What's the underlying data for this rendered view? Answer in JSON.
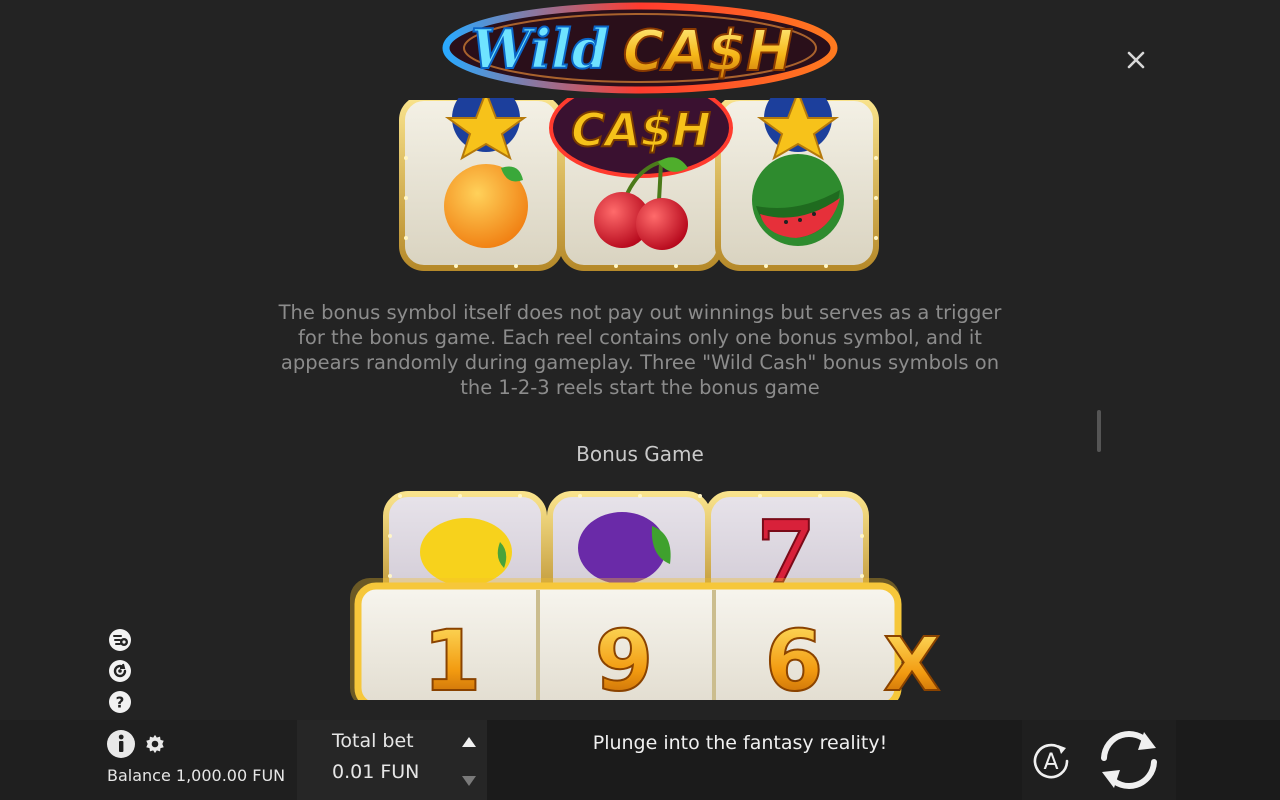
{
  "header": {
    "logo_text_1": "Wild",
    "logo_text_2": "CA$H",
    "close_icon": "close-icon"
  },
  "content": {
    "illustration_1": {
      "cash_text": "CA$H",
      "symbols": [
        "star-icon",
        "orange-icon",
        "cherry-icon",
        "watermelon-icon"
      ]
    },
    "description": "The bonus symbol itself does not pay out winnings but serves as a trigger for the bonus game. Each reel contains only one bonus symbol, and it appears randomly during gameplay. Three \"Wild Cash\" bonus symbols on the 1-2-3 reels start the bonus game",
    "section_title": "Bonus Game",
    "illustration_2": {
      "symbols": [
        "lemon-icon",
        "plum-icon",
        "seven-icon"
      ],
      "digits": [
        "1",
        "9",
        "6"
      ],
      "multiplier": "X"
    }
  },
  "side_icons": [
    "coin-bag-icon",
    "history-icon",
    "help-icon"
  ],
  "bottom_bar": {
    "balance": "Balance 1,000.00 FUN",
    "total_bet_label": "Total bet",
    "total_bet_value": "0.01 FUN",
    "message": "Plunge into the fantasy reality!",
    "autoplay_label": "A"
  },
  "colors": {
    "background": "#232323",
    "gold": "#f2b81c",
    "logo_blue": "#2ec8ff",
    "logo_red": "#e5322d"
  }
}
